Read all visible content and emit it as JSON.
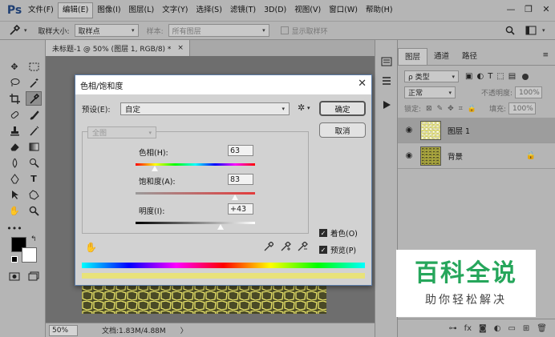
{
  "menubar": {
    "logo": "Ps",
    "items": [
      "文件(F)",
      "编辑(E)",
      "图像(I)",
      "图层(L)",
      "文字(Y)",
      "选择(S)",
      "滤镜(T)",
      "3D(D)",
      "视图(V)",
      "窗口(W)",
      "帮助(H)"
    ],
    "active_index": 1,
    "win_minimize": "—",
    "win_restore": "❐",
    "win_close": "✕"
  },
  "optbar": {
    "sample_size_label": "取样大小:",
    "sample_size_value": "取样点",
    "sample_label": "样本:",
    "sample_value": "所有图层",
    "show_ring_label": "显示取样环"
  },
  "document": {
    "tab_title": "未标题-1 @ 50% (图层 1, RGB/8) *",
    "tab_close": "×",
    "zoom": "50%",
    "doc_info": "文档:1.83M/4.88M",
    "arrow": "〉"
  },
  "layers_panel": {
    "tabs": [
      "图层",
      "通道",
      "路径"
    ],
    "active_tab": 0,
    "filter_label": "ρ 类型",
    "blend_mode": "正常",
    "opacity_label": "不透明度:",
    "opacity_value": "100%",
    "lock_label": "锁定:",
    "fill_label": "填充:",
    "fill_value": "100%",
    "layers": [
      {
        "name": "图层 1",
        "selected": true,
        "locked": false
      },
      {
        "name": "背景",
        "selected": false,
        "locked": true
      }
    ]
  },
  "dialog": {
    "title": "色相/饱和度",
    "close": "✕",
    "preset_label": "预设(E):",
    "preset_value": "自定",
    "ok_label": "确定",
    "cancel_label": "取消",
    "channel_value": "全图",
    "hue_label": "色相(H):",
    "hue_value": "63",
    "saturation_label": "饱和度(A):",
    "saturation_value": "83",
    "lightness_label": "明度(I):",
    "lightness_value": "+43",
    "colorize_label": "着色(O)",
    "preview_label": "预览(P)",
    "colorize_checked": true,
    "preview_checked": true
  },
  "watermark": {
    "title": "百科全说",
    "subtitle": "助你轻松解决"
  },
  "colors": {
    "ui_gray": "#b5b5b5",
    "canvas_bg": "#6e6e6e",
    "brand_green": "#26a65b",
    "yellow_result": "#e8e27a"
  }
}
